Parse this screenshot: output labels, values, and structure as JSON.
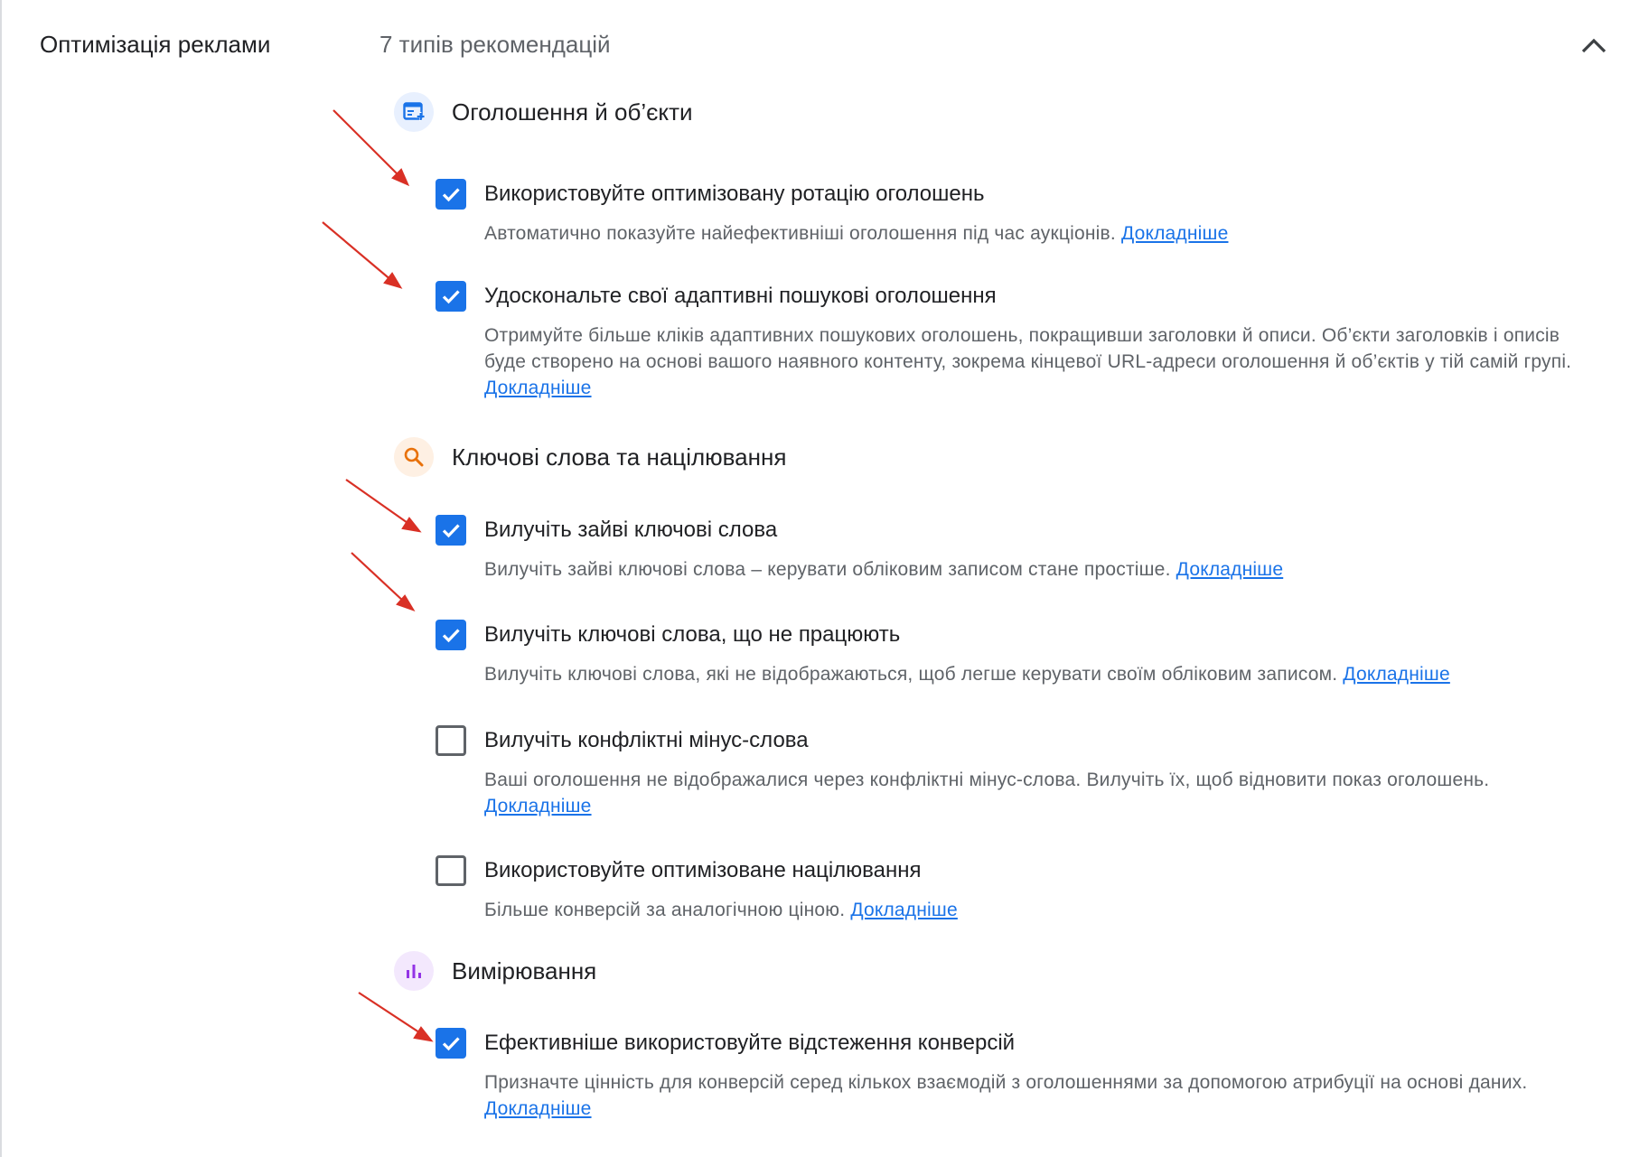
{
  "section": {
    "title": "Оптимізація реклами",
    "summary": "7 типів рекомендацій"
  },
  "colors": {
    "accent": "#1a73e8",
    "arrow": "#d93025"
  },
  "groups": [
    {
      "title": "Оголошення й об’єкти",
      "icon": "ad-creative-icon",
      "items": [
        {
          "title": "Використовуйте оптимізовану ротацію оголошень",
          "desc": "Автоматично показуйте найефективніші оголошення під час аукціонів.",
          "link": "Докладніше",
          "checked": true
        },
        {
          "title": "Удоскональте свої адаптивні пошукові оголошення",
          "desc": "Отримуйте більше кліків адаптивних пошукових оголошень, покращивши заголовки й описи. Об’єкти заголовків і описів буде створено на основі вашого наявного контенту, зокрема кінцевої URL-адреси оголошення й об’єктів у тій самій групі.",
          "link": "Докладніше",
          "checked": true
        }
      ]
    },
    {
      "title": "Ключові слова та націлювання",
      "icon": "search-icon",
      "items": [
        {
          "title": "Вилучіть зайві ключові слова",
          "desc": "Вилучіть зайві ключові слова – керувати обліковим записом стане простіше.",
          "link": "Докладніше",
          "checked": true
        },
        {
          "title": "Вилучіть ключові слова, що не працюють",
          "desc": "Вилучіть ключові слова, які не відображаються, щоб легше керувати своїм обліковим записом.",
          "link": "Докладніше",
          "checked": true
        },
        {
          "title": "Вилучіть конфліктні мінус-слова",
          "desc": "Ваші оголошення не відображалися через конфліктні мінус-слова. Вилучіть їх, щоб відновити показ оголошень.",
          "link": "Докладніше",
          "checked": false
        },
        {
          "title": "Використовуйте оптимізоване націлювання",
          "desc": "Більше конверсій за аналогічною ціною.",
          "link": "Докладніше",
          "checked": false
        }
      ]
    },
    {
      "title": "Вимірювання",
      "icon": "bar-chart-icon",
      "items": [
        {
          "title": "Ефективніше використовуйте відстеження конверсій",
          "desc": "Призначте цінність для конверсій серед кількох взаємодій з оголошеннями за допомогою атрибуції на основі даних.",
          "link": "Докладніше",
          "checked": true
        }
      ]
    }
  ]
}
